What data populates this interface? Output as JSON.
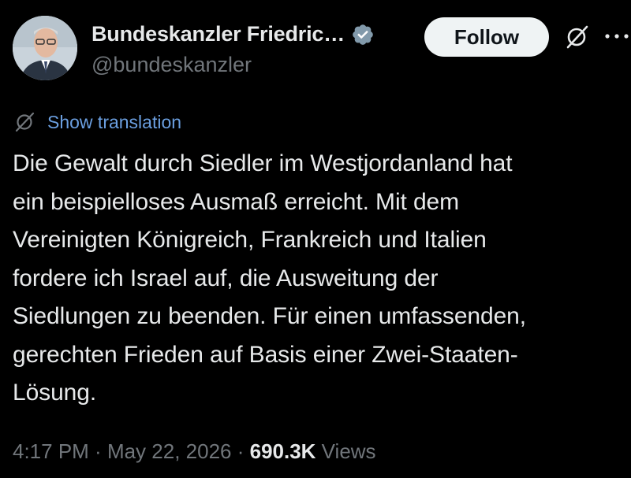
{
  "author": {
    "name": "Bundeskanzler Friedric…",
    "handle": "@bundeskanzler",
    "verified_color": "#829aab"
  },
  "actions": {
    "follow_label": "Follow",
    "grok_icon": "grok-icon",
    "more_icon": "more-horizontal-icon"
  },
  "translation": {
    "label": "Show translation",
    "icon": "translate-icon"
  },
  "post": {
    "lines": [
      "Die Gewalt durch Siedler im Westjordanland hat",
      "ein beispielloses Ausmaß erreicht. Mit dem",
      "Vereinigten Königreich, Frankreich und Italien",
      "fordere ich Israel auf, die Ausweitung der",
      "Siedlungen zu beenden. Für einen umfassenden,",
      "gerechten Frieden auf Basis einer Zwei-Staaten-",
      "Lösung."
    ]
  },
  "meta": {
    "time": "4:17 PM",
    "separator": " · ",
    "date": "May 22, 2026",
    "views_count": "690.3K",
    "views_label": " Views"
  },
  "colors": {
    "background": "#000000",
    "text": "#e7e9ea",
    "muted": "#71767b",
    "link": "#6b9fe0",
    "button_bg": "#eff3f4"
  }
}
